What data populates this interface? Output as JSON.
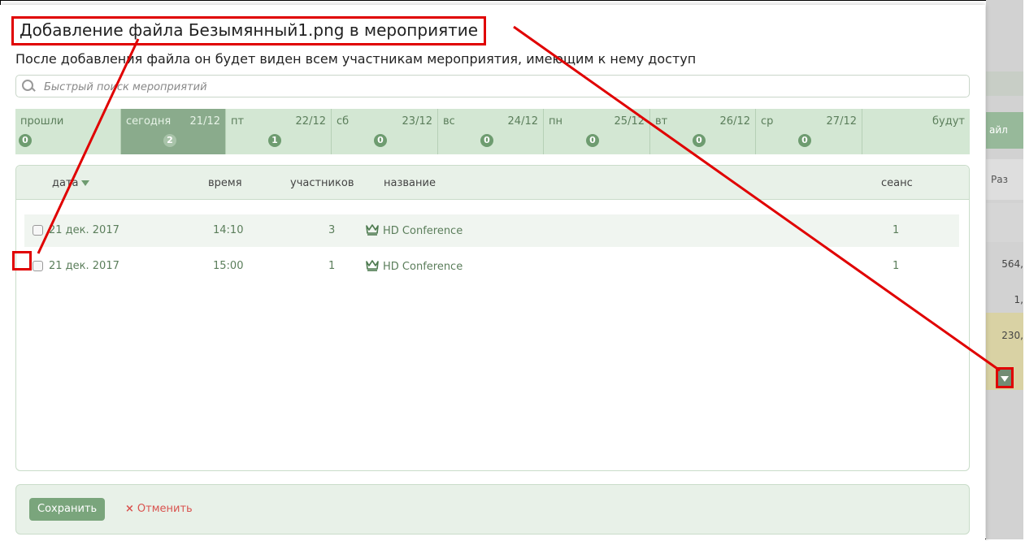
{
  "modal": {
    "title": "Добавление файла Безымянный1.png в мероприятие",
    "subtitle": "После добавления файла он будет виден всем участникам мероприятия, имеющим к нему доступ",
    "search_placeholder": "Быстрый поиск мероприятий"
  },
  "days": [
    {
      "name": "прошли",
      "date": "",
      "count": "0"
    },
    {
      "name": "сегодня",
      "date": "21/12",
      "count": "2",
      "active": true
    },
    {
      "name": "пт",
      "date": "22/12",
      "count": "1"
    },
    {
      "name": "сб",
      "date": "23/12",
      "count": "0"
    },
    {
      "name": "вс",
      "date": "24/12",
      "count": "0"
    },
    {
      "name": "пн",
      "date": "25/12",
      "count": "0"
    },
    {
      "name": "вт",
      "date": "26/12",
      "count": "0"
    },
    {
      "name": "ср",
      "date": "27/12",
      "count": "0"
    },
    {
      "name": "будут",
      "date": "",
      "count": ""
    }
  ],
  "table": {
    "headers": {
      "date": "дата",
      "time": "время",
      "participants": "участников",
      "name": "название",
      "session": "сеанс"
    },
    "rows": [
      {
        "date": "21 дек. 2017",
        "time": "14:10",
        "participants": "3",
        "name": "HD Conference",
        "session": "1"
      },
      {
        "date": "21 дек. 2017",
        "time": "15:00",
        "participants": "1",
        "name": "HD Conference",
        "session": "1"
      }
    ]
  },
  "footer": {
    "save_label": "Сохранить",
    "cancel_label": "Отменить",
    "cancel_icon": "×"
  },
  "background": {
    "header": "айл",
    "col": "Раз",
    "v1": "564,",
    "v2": "1,",
    "v3": "230,"
  },
  "colors": {
    "accent": "#7aa57c",
    "highlight": "#e00000",
    "cancel": "#d9534f"
  }
}
